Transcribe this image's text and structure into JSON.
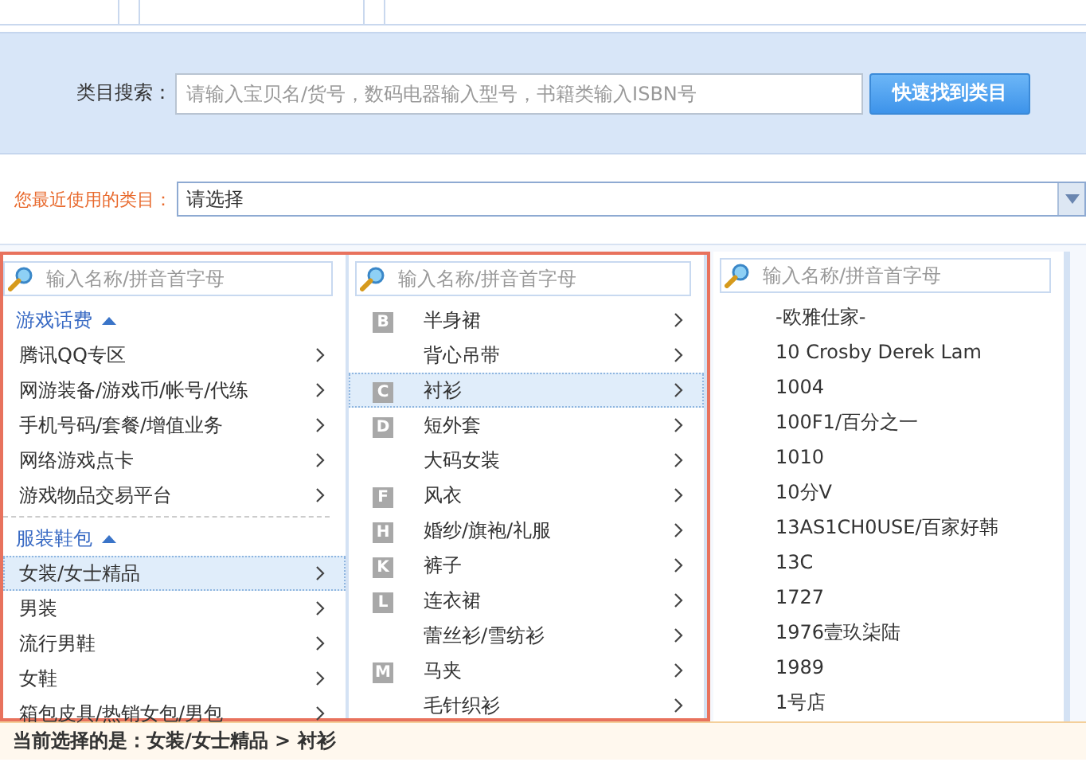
{
  "search": {
    "label": "类目搜索：",
    "placeholder": "请输入宝贝名/货号，数码电器输入型号，书籍类输入ISBN号",
    "button": "快速找到类目"
  },
  "recent": {
    "label": "您最近使用的类目：",
    "value": "请选择"
  },
  "columns": [
    {
      "placeholder": "输入名称/拼音首字母",
      "groups": [
        {
          "title": "游戏话费",
          "expanded": true,
          "items": [
            {
              "label": "腾讯QQ专区",
              "selected": false
            },
            {
              "label": "网游装备/游戏币/帐号/代练",
              "selected": false
            },
            {
              "label": "手机号码/套餐/增值业务",
              "selected": false
            },
            {
              "label": "网络游戏点卡",
              "selected": false
            },
            {
              "label": "游戏物品交易平台",
              "selected": false
            }
          ]
        },
        {
          "title": "服装鞋包",
          "expanded": true,
          "items": [
            {
              "label": "女装/女士精品",
              "selected": true
            },
            {
              "label": "男装",
              "selected": false
            },
            {
              "label": "流行男鞋",
              "selected": false
            },
            {
              "label": "女鞋",
              "selected": false
            },
            {
              "label": "箱包皮具/热销女包/男包",
              "selected": false
            }
          ]
        }
      ]
    },
    {
      "placeholder": "输入名称/拼音首字母",
      "items": [
        {
          "letter": "B",
          "label": "半身裙",
          "selected": false
        },
        {
          "label": "背心吊带",
          "selected": false
        },
        {
          "letter": "C",
          "label": "衬衫",
          "selected": true
        },
        {
          "letter": "D",
          "label": "短外套",
          "selected": false
        },
        {
          "label": "大码女装",
          "selected": false
        },
        {
          "letter": "F",
          "label": "风衣",
          "selected": false
        },
        {
          "letter": "H",
          "label": "婚纱/旗袍/礼服",
          "selected": false
        },
        {
          "letter": "K",
          "label": "裤子",
          "selected": false
        },
        {
          "letter": "L",
          "label": "连衣裙",
          "selected": false
        },
        {
          "label": "蕾丝衫/雪纺衫",
          "selected": false
        },
        {
          "letter": "M",
          "label": "马夹",
          "selected": false
        },
        {
          "label": "毛针织衫",
          "selected": false
        }
      ]
    },
    {
      "placeholder": "输入名称/拼音首字母",
      "items": [
        {
          "label": "-欧雅仕家-"
        },
        {
          "label": "10 Crosby Derek Lam"
        },
        {
          "label": "1004"
        },
        {
          "label": "100F1/百分之一"
        },
        {
          "label": "1010"
        },
        {
          "label": "10分V"
        },
        {
          "label": "13AS1CH0USE/百家好韩"
        },
        {
          "label": "13C"
        },
        {
          "label": "1727"
        },
        {
          "label": "1976壹玖柒陆"
        },
        {
          "label": "1989"
        },
        {
          "label": "1号店"
        }
      ]
    }
  ],
  "selection": {
    "text": "当前选择的是：女装/女士精品 > 衬衫"
  }
}
